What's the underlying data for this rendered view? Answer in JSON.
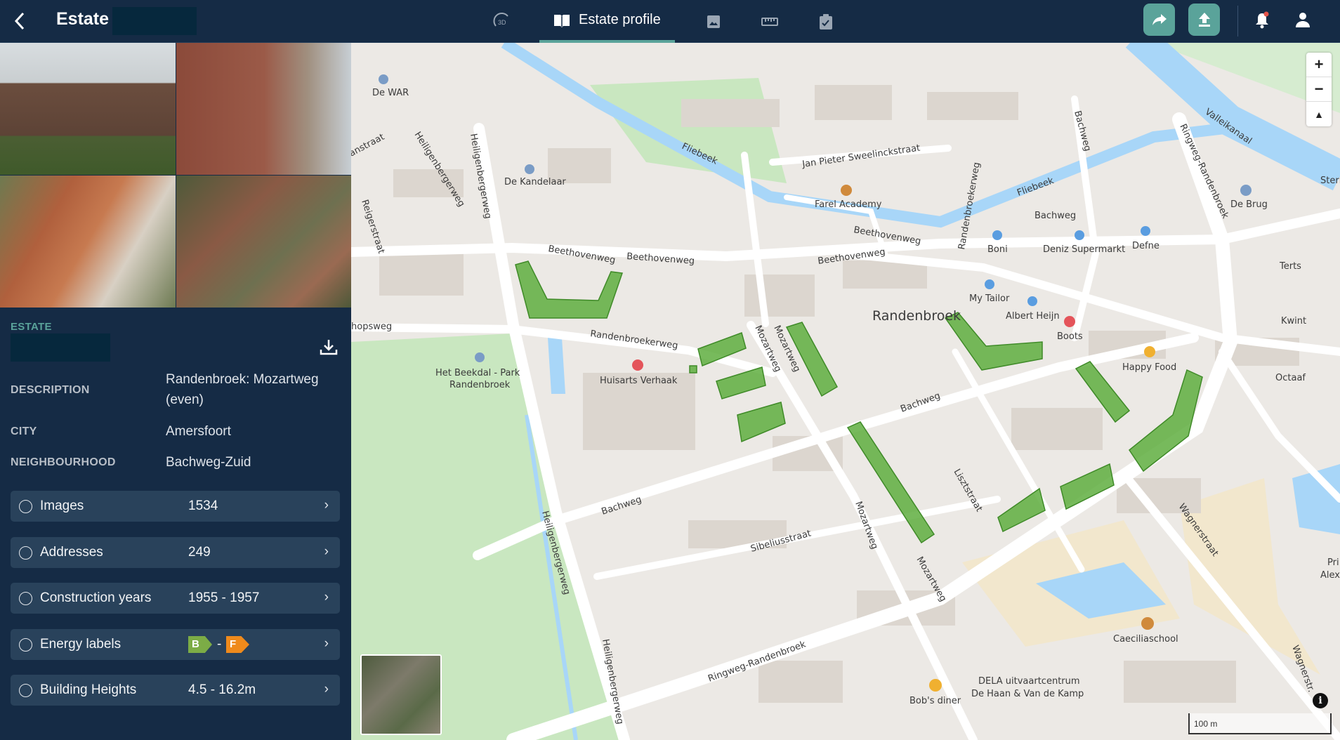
{
  "header": {
    "title": "Estate",
    "tabs": [
      {
        "label": "3D"
      },
      {
        "label": "Estate profile"
      },
      {
        "label": "images"
      },
      {
        "label": "measure"
      },
      {
        "label": "tasks"
      }
    ]
  },
  "sidebar": {
    "section_label": "ESTATE",
    "fields": [
      {
        "label": "DESCRIPTION",
        "value_line1": "Randenbroek: Mozartweg",
        "value_line2": "(even)"
      },
      {
        "label": "CITY",
        "value": "Amersfoort"
      },
      {
        "label": "NEIGHBOURHOOD",
        "value": "Bachweg-Zuid"
      }
    ],
    "cards": [
      {
        "label": "Images",
        "value": "1534"
      },
      {
        "label": "Addresses",
        "value": "249"
      },
      {
        "label": "Construction years",
        "value": "1955 - 1957"
      },
      {
        "label": "Energy labels",
        "from": "B",
        "sep": "-",
        "to": "F",
        "from_color": "#7cac46",
        "to_color": "#ef8a1c"
      },
      {
        "label": "Building Heights",
        "value": "4.5 - 16.2m"
      }
    ]
  },
  "colors": {
    "navy": "#152b45",
    "accent": "#5aa39a",
    "building": "#5fae3f"
  },
  "map": {
    "labels": [
      "De WAR",
      "De Kandelaar",
      "Heiligenbergerweg",
      "Heiligenbergerweg",
      "anstraat",
      "Reigerstraat",
      "Beethovenweg",
      "Beethovenweg",
      "Beethovenweg",
      "Beethovenweg",
      "Fliebeek",
      "Fliebeek",
      "Farel Academy",
      "Jan Pieter Sweelinckstraat",
      "Randenbroekerweg",
      "Bachweg",
      "Bachweg",
      "Ringweg-Randenbroek",
      "Valleikanaal",
      "Sterk",
      "De Brug",
      "Boni",
      "Deniz Supermarkt",
      "Defne",
      "Terts",
      "Kwint",
      "Octaaf",
      "My Tailor",
      "Albert Heijn",
      "Boots",
      "Randenbroek",
      "Happy Food",
      "hopsweg",
      "Randenbroekerweg",
      "Het Beekdal - Park",
      "Randenbroek",
      "Huisarts Verhaak",
      "Mozartweg",
      "Mozartweg",
      "Bachweg",
      "Bachweg",
      "Lisztstraat",
      "Mozartweg",
      "Mozartweg",
      "Sibeliusstraat",
      "Heiligenbergerweg",
      "Heiligenbergerweg",
      "Ringweg-Randenbroek",
      "Wagnerstraat",
      "Wagnerstr.",
      "Caeciliaschool",
      "DELA uitvaartcentrum",
      "De Haan & Van de Kamp",
      "Bob's diner",
      "Pri",
      "Alexa"
    ],
    "zoom_in": "+",
    "zoom_out": "−",
    "compass": "▲",
    "scale": "100 m",
    "info": "i"
  }
}
